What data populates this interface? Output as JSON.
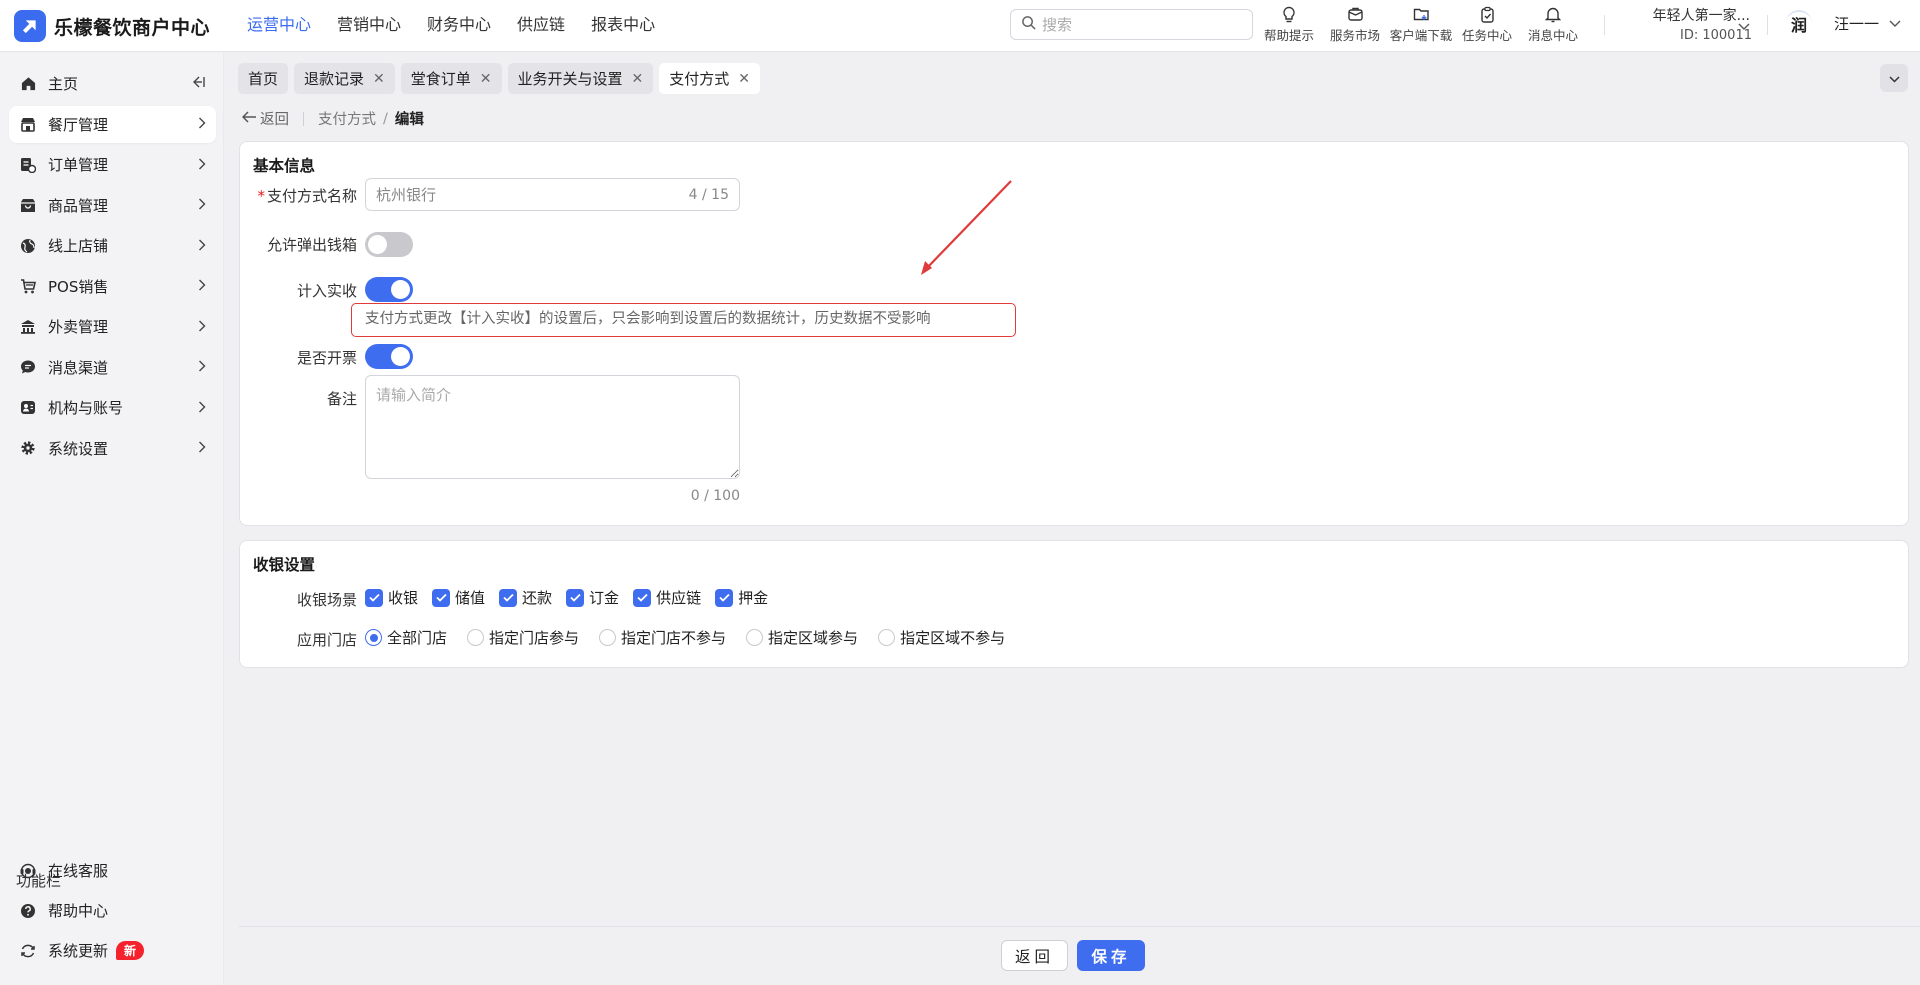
{
  "app": {
    "title": "乐檬餐饮商户中心"
  },
  "topnav": [
    {
      "label": "运营中心",
      "active": true
    },
    {
      "label": "营销中心"
    },
    {
      "label": "财务中心"
    },
    {
      "label": "供应链"
    },
    {
      "label": "报表中心"
    }
  ],
  "search": {
    "placeholder": "搜索"
  },
  "tools": [
    {
      "label": "帮助提示",
      "icon": "lightbulb-icon"
    },
    {
      "label": "服务市场",
      "icon": "store-icon"
    },
    {
      "label": "客户端下载",
      "icon": "download-folder-icon"
    },
    {
      "label": "任务中心",
      "icon": "clipboard-icon"
    },
    {
      "label": "消息中心",
      "icon": "bell-icon"
    }
  ],
  "shop": {
    "name": "年轻人第一家...",
    "id": "ID: 100011"
  },
  "user": {
    "avatar": "润",
    "name": "汪一一"
  },
  "sidebar": {
    "items": [
      {
        "label": "主页",
        "icon": "home-icon"
      },
      {
        "label": "餐厅管理",
        "icon": "restaurant-icon",
        "active": true
      },
      {
        "label": "订单管理",
        "icon": "order-icon"
      },
      {
        "label": "商品管理",
        "icon": "goods-icon"
      },
      {
        "label": "线上店铺",
        "icon": "globe-icon"
      },
      {
        "label": "POS销售",
        "icon": "cart-icon"
      },
      {
        "label": "外卖管理",
        "icon": "delivery-icon"
      },
      {
        "label": "消息渠道",
        "icon": "chat-icon"
      },
      {
        "label": "机构与账号",
        "icon": "account-icon"
      },
      {
        "label": "系统设置",
        "icon": "gear-icon"
      }
    ],
    "function_title": "功能栏",
    "functions": [
      {
        "label": "在线客服",
        "icon": "headset-icon"
      },
      {
        "label": "帮助中心",
        "icon": "help-icon"
      },
      {
        "label": "系统更新",
        "icon": "refresh-icon",
        "badge": "新"
      }
    ]
  },
  "tabs": [
    {
      "label": "首页",
      "closable": false
    },
    {
      "label": "退款记录",
      "closable": true
    },
    {
      "label": "堂食订单",
      "closable": true
    },
    {
      "label": "业务开关与设置",
      "closable": true
    },
    {
      "label": "支付方式",
      "closable": true,
      "active": true
    }
  ],
  "breadcrumb": {
    "back": "返回",
    "parent": "支付方式",
    "current": "编辑"
  },
  "basic": {
    "title": "基本信息",
    "name_label": "支付方式名称",
    "name_value": "杭州银行",
    "name_count": "4 / 15",
    "cashbox_label": "允许弹出钱箱",
    "cashbox_on": false,
    "revenue_label": "计入实收",
    "revenue_on": true,
    "notice": "支付方式更改【计入实收】的设置后，只会影响到设置后的数据统计，历史数据不受影响",
    "invoice_label": "是否开票",
    "invoice_on": true,
    "remark_label": "备注",
    "remark_placeholder": "请输入简介",
    "remark_count": "0 / 100"
  },
  "cashier": {
    "title": "收银设置",
    "scene_label": "收银场景",
    "scenes": [
      {
        "label": "收银",
        "checked": true
      },
      {
        "label": "储值",
        "checked": true
      },
      {
        "label": "还款",
        "checked": true
      },
      {
        "label": "订金",
        "checked": true
      },
      {
        "label": "供应链",
        "checked": true
      },
      {
        "label": "押金",
        "checked": true
      }
    ],
    "store_label": "应用门店",
    "stores": [
      {
        "label": "全部门店",
        "selected": true
      },
      {
        "label": "指定门店参与"
      },
      {
        "label": "指定门店不参与"
      },
      {
        "label": "指定区域参与"
      },
      {
        "label": "指定区域不参与"
      }
    ]
  },
  "footer": {
    "back": "返回",
    "save": "保存"
  },
  "colors": {
    "accent": "#3f6df0",
    "alert": "#e03a3a",
    "badge": "#f5222d"
  }
}
